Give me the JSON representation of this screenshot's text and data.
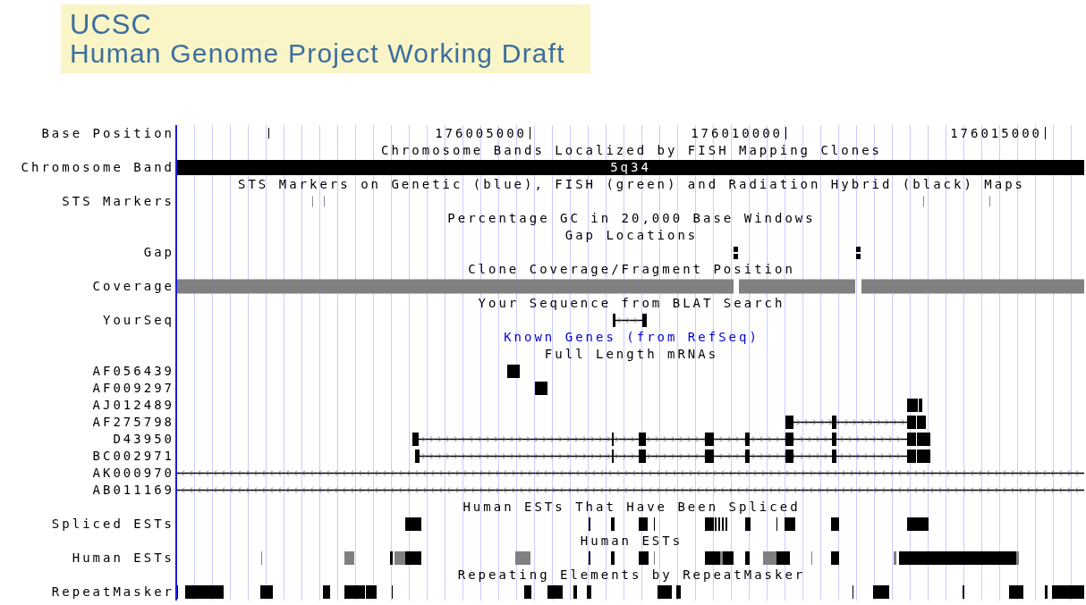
{
  "logo": {
    "title": "UCSC",
    "subtitle": "Human Genome Project Working Draft"
  },
  "tracks": [
    {
      "kind": "ruler",
      "label": "Base Position",
      "positions": [
        "176005000",
        "176010000",
        "176015000"
      ]
    },
    {
      "kind": "title",
      "text": "Chromosome Bands Localized by FISH Mapping Clones",
      "link": false
    },
    {
      "kind": "band",
      "label": "Chromosome Band",
      "band": "5q34"
    },
    {
      "kind": "title",
      "text": "STS Markers on Genetic (blue), FISH (green) and Radiation Hybrid (black) Maps",
      "link": false
    },
    {
      "kind": "track",
      "label": "STS Markers"
    },
    {
      "kind": "title",
      "text": "Percentage GC in 20,000 Base Windows",
      "link": false
    },
    {
      "kind": "title",
      "text": "Gap Locations",
      "link": false
    },
    {
      "kind": "track",
      "label": "Gap"
    },
    {
      "kind": "title",
      "text": "Clone Coverage/Fragment Position",
      "link": false
    },
    {
      "kind": "track",
      "label": "Coverage"
    },
    {
      "kind": "title",
      "text": "Your Sequence from BLAT Search",
      "link": false
    },
    {
      "kind": "track",
      "label": "YourSeq"
    },
    {
      "kind": "title",
      "text": "Known Genes (from RefSeq)",
      "link": true
    },
    {
      "kind": "title",
      "text": "Full Length mRNAs",
      "link": false
    },
    {
      "kind": "track",
      "label": "AF056439"
    },
    {
      "kind": "track",
      "label": "AF009297"
    },
    {
      "kind": "track",
      "label": "AJ012489"
    },
    {
      "kind": "track",
      "label": "AF275798"
    },
    {
      "kind": "track",
      "label": "D43950"
    },
    {
      "kind": "track",
      "label": "BC002971"
    },
    {
      "kind": "track",
      "label": "AK000970"
    },
    {
      "kind": "track",
      "label": "AB011169"
    },
    {
      "kind": "title",
      "text": "Human ESTs That Have Been Spliced",
      "link": false
    },
    {
      "kind": "track",
      "label": "Spliced ESTs"
    },
    {
      "kind": "title",
      "text": "Human ESTs",
      "link": false
    },
    {
      "kind": "track",
      "label": "Human ESTs"
    },
    {
      "kind": "title",
      "text": "Repeating Elements by RepeatMasker",
      "link": false
    },
    {
      "kind": "track",
      "label": "RepeatMasker"
    }
  ]
}
